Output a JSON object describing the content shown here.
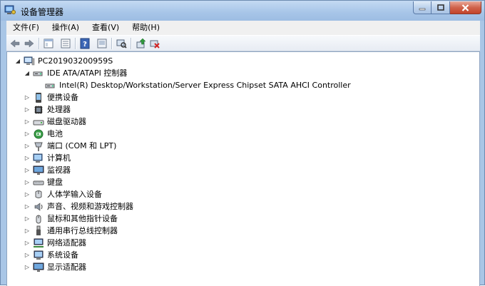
{
  "window": {
    "title": "设备管理器",
    "controls": {
      "minimize": "minimize",
      "maximize": "maximize",
      "close": "close"
    }
  },
  "menu": [
    {
      "label": "文件(F)"
    },
    {
      "label": "操作(A)"
    },
    {
      "label": "查看(V)"
    },
    {
      "label": "帮助(H)"
    }
  ],
  "toolbar": [
    {
      "icon": "back-arrow-icon"
    },
    {
      "icon": "forward-arrow-icon"
    },
    {
      "icon": "properties-sheet-icon"
    },
    {
      "icon": "list-view-icon"
    },
    {
      "icon": "help-icon"
    },
    {
      "icon": "device-view-icon"
    },
    {
      "icon": "scan-hardware-icon"
    },
    {
      "icon": "update-driver-icon"
    },
    {
      "icon": "uninstall-device-icon"
    }
  ],
  "tree": {
    "root": {
      "label": "PC201903200959S",
      "icon": "computer-icon",
      "expanded": true
    },
    "items": [
      {
        "label": "IDE ATA/ATAPI 控制器",
        "icon": "ide-controller-icon",
        "expanded": true,
        "children": [
          {
            "label": "Intel(R) Desktop/Workstation/Server Express Chipset SATA AHCI Controller",
            "icon": "ide-controller-icon"
          }
        ]
      },
      {
        "label": "便携设备",
        "icon": "portable-device-icon"
      },
      {
        "label": "处理器",
        "icon": "processor-icon"
      },
      {
        "label": "磁盘驱动器",
        "icon": "disk-drive-icon"
      },
      {
        "label": "电池",
        "icon": "battery-icon"
      },
      {
        "label": "端口 (COM 和 LPT)",
        "icon": "port-icon"
      },
      {
        "label": "计算机",
        "icon": "computer-icon"
      },
      {
        "label": "监视器",
        "icon": "monitor-icon"
      },
      {
        "label": "键盘",
        "icon": "keyboard-icon"
      },
      {
        "label": "人体学输入设备",
        "icon": "hid-icon"
      },
      {
        "label": "声音、视频和游戏控制器",
        "icon": "sound-icon"
      },
      {
        "label": "鼠标和其他指针设备",
        "icon": "mouse-icon"
      },
      {
        "label": "通用串行总线控制器",
        "icon": "usb-icon"
      },
      {
        "label": "网络适配器",
        "icon": "network-adapter-icon"
      },
      {
        "label": "系统设备",
        "icon": "system-device-icon"
      },
      {
        "label": "显示适配器",
        "icon": "display-adapter-icon"
      }
    ]
  }
}
